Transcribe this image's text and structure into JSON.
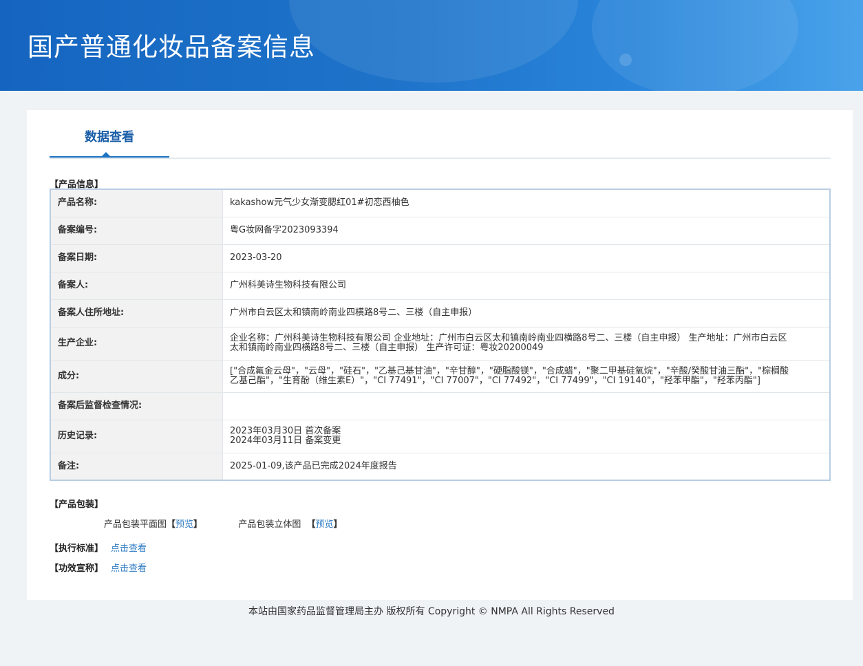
{
  "header": {
    "title": "国产普通化妆品备案信息"
  },
  "tabs": [
    {
      "label": "数据查看"
    }
  ],
  "product_info": {
    "section_title": "【产品信息】",
    "rows": [
      {
        "label": "产品名称:",
        "value": "kakashow元气少女渐变腮红01#初恋西柚色"
      },
      {
        "label": "备案编号:",
        "value": "粤G妆网备字2023093394"
      },
      {
        "label": "备案日期:",
        "value": "2023-03-20"
      },
      {
        "label": "备案人:",
        "value": "广州科美诗生物科技有限公司"
      },
      {
        "label": "备案人住所地址:",
        "value": "广州市白云区太和镇南岭南业四横路8号二、三楼（自主申报）"
      },
      {
        "label": "生产企业:",
        "value": "企业名称：广州科美诗生物科技有限公司 企业地址：广州市白云区太和镇南岭南业四横路8号二、三楼（自主申报） 生产地址：广州市白云区太和镇南岭南业四横路8号二、三楼（自主申报） 生产许可证：粤妆20200049"
      },
      {
        "label": "成分:",
        "value": "[\"合成氟金云母\"，\"云母\"，\"硅石\"，\"乙基己基甘油\"，\"辛甘醇\"，\"硬脂酸镁\"，\"合成蜡\"，\"聚二甲基硅氧烷\"，\"辛酸/癸酸甘油三酯\"，\"棕榈酸乙基己酯\"，\"生育酚（维生素E）\"，\"CI 77491\"，\"CI 77007\"，\"CI 77492\"，\"CI 77499\"，\"CI 19140\"，\"羟苯甲酯\"，\"羟苯丙酯\"]"
      },
      {
        "label": "备案后监督检查情况:",
        "value": ""
      },
      {
        "label": "历史记录:",
        "value_lines": [
          "2023年03月30日 首次备案",
          "2024年03月11日 备案变更"
        ]
      },
      {
        "label": "备注:",
        "value": "2025-01-09,该产品已完成2024年度报告"
      }
    ]
  },
  "packaging": {
    "section_title": "【产品包装】",
    "flat_label": "产品包装平面图",
    "flat_link": "预览",
    "stereo_label": "产品包装立体图",
    "stereo_link": "预览",
    "open_bracket": "【",
    "close_bracket": "】"
  },
  "standard": {
    "section_title": "【执行标准】",
    "link": "点击查看"
  },
  "efficacy": {
    "section_title": "【功效宣称】",
    "link": "点击查看"
  },
  "footer": {
    "text": "本站由国家药品监督管理局主办 版权所有 Copyright © NMPA All Rights Reserved"
  }
}
